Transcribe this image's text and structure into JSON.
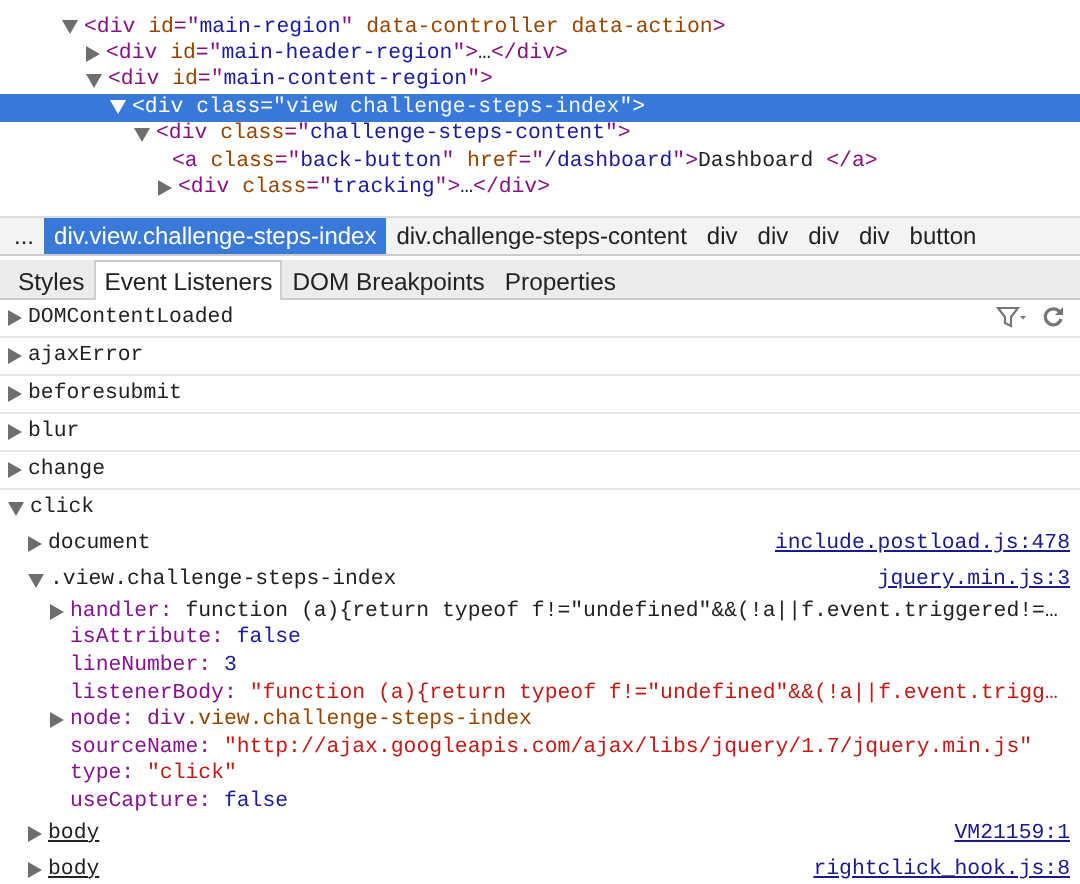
{
  "dom_tree": [
    {
      "kind": "element",
      "expanded": true,
      "selected": false,
      "tokens": [
        {
          "kind": "tag",
          "text": "<div"
        },
        {
          "kind": "attr",
          "text": " id"
        },
        {
          "kind": "tag",
          "text": "=\""
        },
        {
          "kind": "value",
          "text": "main-region"
        },
        {
          "kind": "tag",
          "text": "\""
        },
        {
          "kind": "attr",
          "text": " data-controller data-action"
        },
        {
          "kind": "tag",
          "text": ">"
        }
      ],
      "children": [
        {
          "kind": "element",
          "expanded": false,
          "selected": false,
          "tokens": [
            {
              "kind": "tag",
              "text": "<div"
            },
            {
              "kind": "attr",
              "text": " id"
            },
            {
              "kind": "tag",
              "text": "=\""
            },
            {
              "kind": "value",
              "text": "main-header-region"
            },
            {
              "kind": "tag",
              "text": "\">"
            },
            {
              "kind": "text",
              "text": "…"
            },
            {
              "kind": "tag",
              "text": "</div>"
            }
          ]
        },
        {
          "kind": "element",
          "expanded": true,
          "selected": false,
          "tokens": [
            {
              "kind": "tag",
              "text": "<div"
            },
            {
              "kind": "attr",
              "text": " id"
            },
            {
              "kind": "tag",
              "text": "=\""
            },
            {
              "kind": "value",
              "text": "main-content-region"
            },
            {
              "kind": "tag",
              "text": "\">"
            }
          ],
          "children": [
            {
              "kind": "element",
              "expanded": true,
              "selected": true,
              "tokens": [
                {
                  "kind": "tag",
                  "text": "<div"
                },
                {
                  "kind": "attr",
                  "text": " class"
                },
                {
                  "kind": "tag",
                  "text": "=\""
                },
                {
                  "kind": "value",
                  "text": "view challenge-steps-index"
                },
                {
                  "kind": "tag",
                  "text": "\">"
                }
              ],
              "children": [
                {
                  "kind": "element",
                  "expanded": true,
                  "selected": false,
                  "tokens": [
                    {
                      "kind": "tag",
                      "text": "<div"
                    },
                    {
                      "kind": "attr",
                      "text": " class"
                    },
                    {
                      "kind": "tag",
                      "text": "=\""
                    },
                    {
                      "kind": "value",
                      "text": "challenge-steps-content"
                    },
                    {
                      "kind": "tag",
                      "text": "\">"
                    }
                  ],
                  "children": [
                    {
                      "kind": "leaf",
                      "selected": false,
                      "tokens": [
                        {
                          "kind": "tag",
                          "text": "<a"
                        },
                        {
                          "kind": "attr",
                          "text": " class"
                        },
                        {
                          "kind": "tag",
                          "text": "=\""
                        },
                        {
                          "kind": "value",
                          "text": "back-button"
                        },
                        {
                          "kind": "tag",
                          "text": "\""
                        },
                        {
                          "kind": "attr",
                          "text": " href"
                        },
                        {
                          "kind": "tag",
                          "text": "=\""
                        },
                        {
                          "kind": "value",
                          "text": "/dashboard"
                        },
                        {
                          "kind": "tag",
                          "text": "\">"
                        },
                        {
                          "kind": "text",
                          "text": "Dashboard "
                        },
                        {
                          "kind": "tag",
                          "text": "</a>"
                        }
                      ]
                    },
                    {
                      "kind": "element",
                      "expanded": false,
                      "selected": false,
                      "tokens": [
                        {
                          "kind": "tag",
                          "text": "<div"
                        },
                        {
                          "kind": "attr",
                          "text": " class"
                        },
                        {
                          "kind": "tag",
                          "text": "=\""
                        },
                        {
                          "kind": "value",
                          "text": "tracking"
                        },
                        {
                          "kind": "tag",
                          "text": "\">"
                        },
                        {
                          "kind": "text",
                          "text": "…"
                        },
                        {
                          "kind": "tag",
                          "text": "</div>"
                        }
                      ]
                    }
                  ]
                }
              ]
            }
          ]
        }
      ]
    }
  ],
  "breadcrumbs": [
    {
      "label": "...",
      "selected": false
    },
    {
      "label": "div.view.challenge-steps-index",
      "selected": true
    },
    {
      "label": "div.challenge-steps-content",
      "selected": false
    },
    {
      "label": "div",
      "selected": false
    },
    {
      "label": "div",
      "selected": false
    },
    {
      "label": "div",
      "selected": false
    },
    {
      "label": "div",
      "selected": false
    },
    {
      "label": "button",
      "selected": false
    }
  ],
  "tabs": [
    {
      "label": "Styles",
      "selected": false
    },
    {
      "label": "Event Listeners",
      "selected": true
    },
    {
      "label": "DOM Breakpoints",
      "selected": false
    },
    {
      "label": "Properties",
      "selected": false
    }
  ],
  "events": [
    {
      "name": "DOMContentLoaded",
      "expanded": false
    },
    {
      "name": "ajaxError",
      "expanded": false
    },
    {
      "name": "beforesubmit",
      "expanded": false
    },
    {
      "name": "blur",
      "expanded": false
    },
    {
      "name": "change",
      "expanded": false
    },
    {
      "name": "click",
      "expanded": true,
      "listeners": [
        {
          "target": "document",
          "underlined": false,
          "link": "include.postload.js:478",
          "expanded": false
        },
        {
          "target": ".view.challenge-steps-index",
          "underlined": false,
          "link": "jquery.min.js:3",
          "expanded": true,
          "properties": [
            {
              "key": "handler:",
              "expandable": true,
              "value": [
                {
                  "kind": "text",
                  "text": "function (a){return typeof f!=\"undefined\"&&(!a||f.event.triggered!=…"
                }
              ]
            },
            {
              "key": "isAttribute:",
              "expandable": false,
              "value": [
                {
                  "kind": "keyword",
                  "text": "false"
                }
              ]
            },
            {
              "key": "lineNumber:",
              "expandable": false,
              "value": [
                {
                  "kind": "keyword",
                  "text": "3"
                }
              ]
            },
            {
              "key": "listenerBody:",
              "expandable": false,
              "value": [
                {
                  "kind": "string",
                  "text": "\"function (a){return typeof f!=\"undefined\"&&(!a||f.event.trigg…"
                }
              ]
            },
            {
              "key": "node:",
              "expandable": true,
              "value": [
                {
                  "kind": "tag",
                  "text": "div"
                },
                {
                  "kind": "attr",
                  "text": ".view.challenge-steps-index"
                }
              ]
            },
            {
              "key": "sourceName:",
              "expandable": false,
              "value": [
                {
                  "kind": "string",
                  "text": "\"http://ajax.googleapis.com/ajax/libs/jquery/1.7/jquery.min.js\""
                }
              ]
            },
            {
              "key": "type:",
              "expandable": false,
              "value": [
                {
                  "kind": "string",
                  "text": "\"click\""
                }
              ]
            },
            {
              "key": "useCapture:",
              "expandable": false,
              "value": [
                {
                  "kind": "keyword",
                  "text": "false"
                }
              ]
            }
          ]
        },
        {
          "target": "body",
          "underlined": true,
          "link": "VM21159:1",
          "expanded": false
        },
        {
          "target": "body",
          "underlined": true,
          "link": "rightclick_hook.js:8",
          "expanded": false
        }
      ]
    }
  ]
}
